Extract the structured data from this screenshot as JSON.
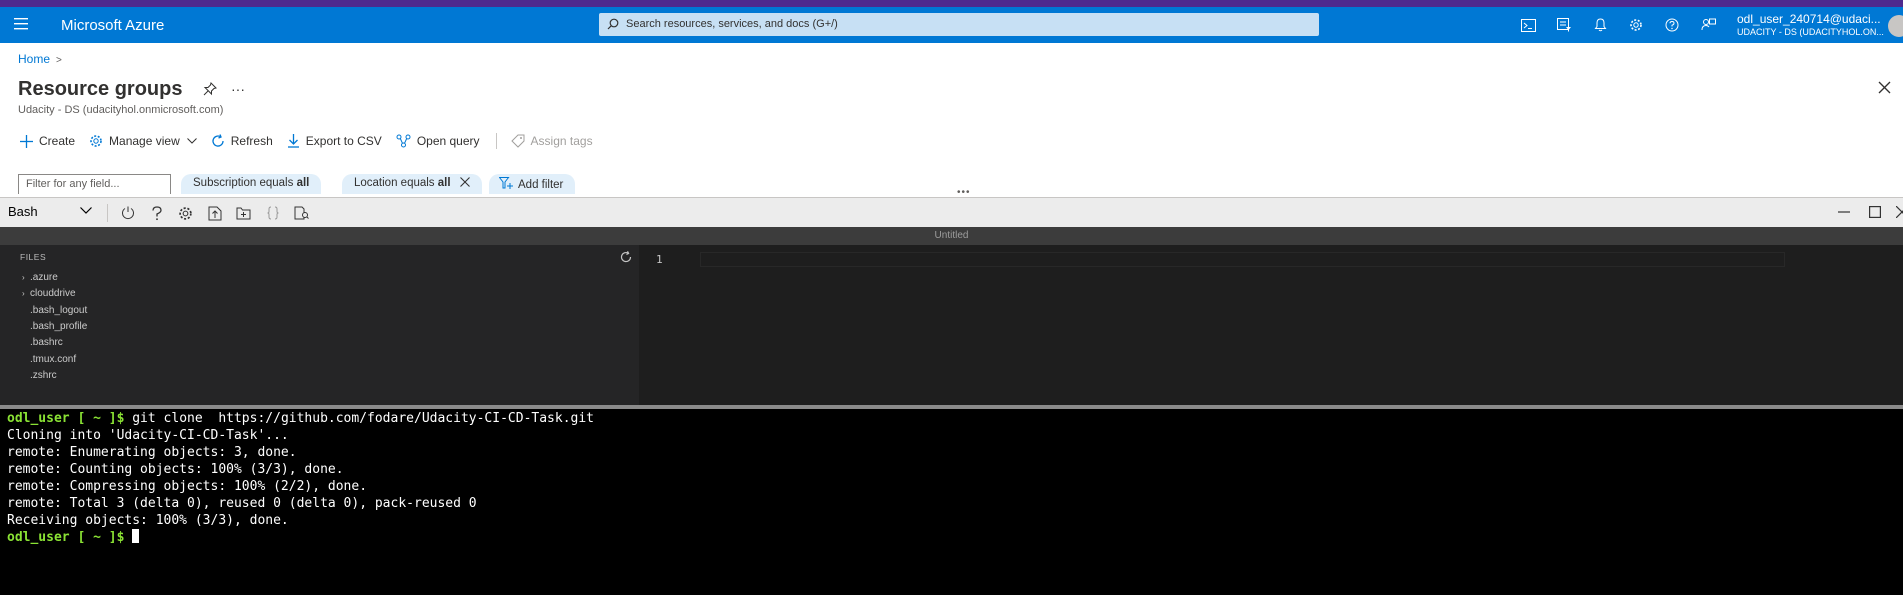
{
  "topbar": {
    "brand": "Microsoft Azure",
    "search_placeholder": "Search resources, services, and docs (G+/)",
    "icons": [
      "cloud-shell-icon",
      "directory-filter-icon",
      "notifications-icon",
      "settings-icon",
      "help-icon",
      "feedback-icon"
    ],
    "account_user": "odl_user_240714@udaci...",
    "account_tenant": "UDACITY - DS (UDACITYHOL.ON..."
  },
  "breadcrumb": {
    "home": "Home",
    "chevron": ">"
  },
  "page": {
    "title": "Resource groups",
    "more": "···",
    "subtitle": "Udacity - DS (udacityhol.onmicrosoft.com)"
  },
  "commands": {
    "create": "Create",
    "manage_view": "Manage view",
    "refresh": "Refresh",
    "export_csv": "Export to CSV",
    "open_query": "Open query",
    "assign_tags": "Assign tags"
  },
  "filters": {
    "placeholder": "Filter for any field...",
    "subscription_label": "Subscription equals ",
    "subscription_value": "all",
    "location_label": "Location equals ",
    "location_value": "all",
    "add_filter": "Add filter",
    "grip": "•••"
  },
  "shell": {
    "selector": "Bash",
    "toolbar_icons": [
      "restart-icon",
      "help-icon",
      "settings-icon",
      "upload-download-icon",
      "open-folder-icon",
      "editor-braces-icon",
      "web-preview-icon"
    ]
  },
  "editor": {
    "tab_title": "Untitled",
    "files_header": "FILES",
    "files": [
      {
        "name": ".azure",
        "folder": true
      },
      {
        "name": "clouddrive",
        "folder": true
      },
      {
        "name": ".bash_logout",
        "folder": false
      },
      {
        "name": ".bash_profile",
        "folder": false
      },
      {
        "name": ".bashrc",
        "folder": false
      },
      {
        "name": ".tmux.conf",
        "folder": false
      },
      {
        "name": ".zshrc",
        "folder": false
      }
    ],
    "line_number": "1"
  },
  "terminal": {
    "prompt": "odl_user [ ~ ]$",
    "command": " git clone  https://github.com/fodare/Udacity-CI-CD-Task.git",
    "output": [
      "Cloning into 'Udacity-CI-CD-Task'...",
      "remote: Enumerating objects: 3, done.",
      "remote: Counting objects: 100% (3/3), done.",
      "remote: Compressing objects: 100% (2/2), done.",
      "remote: Total 3 (delta 0), reused 0 (delta 0), pack-reused 0",
      "Receiving objects: 100% (3/3), done."
    ],
    "final_prompt": "odl_user [ ~ ]$"
  }
}
